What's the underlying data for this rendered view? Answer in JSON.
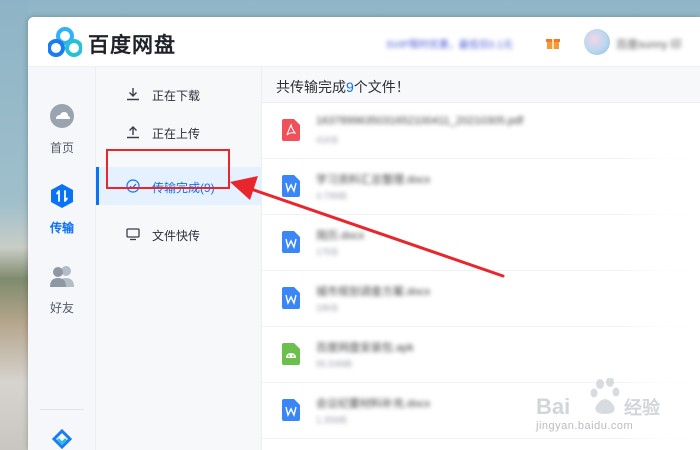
{
  "app": {
    "brand": "百度网盘",
    "promo": "SVIP限时优惠，最低仅0.1元",
    "username": "百度sunny",
    "username_tail": "印"
  },
  "nav": {
    "items": [
      {
        "label": "首页",
        "icon": "cloud-home-icon",
        "active": false
      },
      {
        "label": "传输",
        "icon": "transfer-icon",
        "active": true
      },
      {
        "label": "好友",
        "icon": "friends-icon",
        "active": false
      }
    ]
  },
  "submenu": {
    "items": [
      {
        "label": "正在下载",
        "icon": "download-icon"
      },
      {
        "label": "正在上传",
        "icon": "upload-icon"
      },
      {
        "label": "传输完成(9)",
        "icon": "check-circle-icon",
        "active": true
      },
      {
        "label": "文件快传",
        "icon": "monitor-icon"
      }
    ]
  },
  "content": {
    "title_prefix": "共传输完成",
    "count": "9",
    "title_suffix": "个文件！"
  },
  "files": [
    {
      "name": "1637899635031652100411_20210305.pdf",
      "size": "41KB",
      "type": "pdf"
    },
    {
      "name": "学习资料汇总整理.docx",
      "size": "4.79MB",
      "type": "doc"
    },
    {
      "name": "简历.docx",
      "size": "17KB",
      "type": "doc"
    },
    {
      "name": "城市规划调查方案.docx",
      "size": "18KB",
      "type": "doc"
    },
    {
      "name": "百度网盘安装包.apk",
      "size": "95.54MB",
      "type": "apk"
    },
    {
      "name": "会议纪要材料补充.docx",
      "size": "1.35MB",
      "type": "doc"
    }
  ],
  "watermark": {
    "brand_prefix": "Bai",
    "brand_suffix": "经验",
    "url": "jingyan.baidu.com"
  },
  "colors": {
    "accent": "#0a72f5",
    "annotation": "#e8262b",
    "pdf": "#f0505a",
    "doc": "#3a86f5",
    "apk": "#6ac04a"
  }
}
